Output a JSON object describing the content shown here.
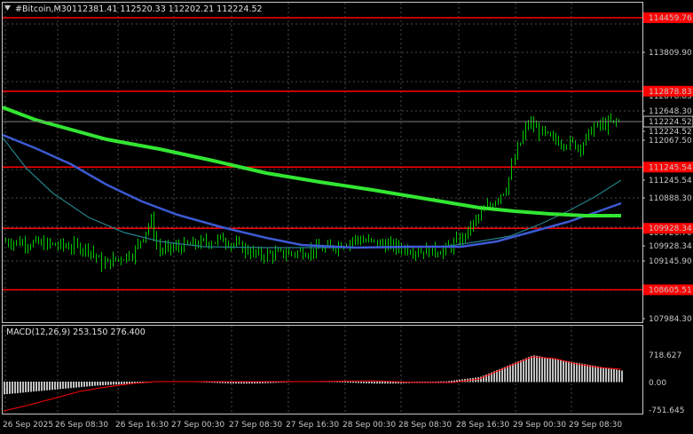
{
  "header": {
    "symbol": "#Bitcoin,M30",
    "ohlc": "112381.41 112520.33 112202.21 112224.52",
    "direction_arrow": "triangle-down-icon"
  },
  "price_axis": {
    "labels": [
      "114459.76",
      "113809.90",
      "112878.83",
      "112648.30",
      "112224.52",
      "112067.50",
      "111486.70",
      "111245.54",
      "110888.30",
      "110307.50",
      "109928.34",
      "109726.70",
      "109145.90",
      "108605.51",
      "107984.30"
    ]
  },
  "level_labels": [
    {
      "text": "114459.76",
      "price": 114459.76
    },
    {
      "text": "112878.83",
      "price": 112878.83
    },
    {
      "text": "111245.54",
      "price": 111245.54
    },
    {
      "text": "109928.34",
      "price": 109928.34
    },
    {
      "text": "108605.51",
      "price": 108605.51
    }
  ],
  "current_price": "112224.52",
  "time_axis": {
    "labels": [
      "26 Sep 2025",
      "26 Sep 08:30",
      "26 Sep 16:30",
      "27 Sep 00:30",
      "27 Sep 08:30",
      "27 Sep 16:30",
      "28 Sep 00:30",
      "28 Sep 08:30",
      "28 Sep 16:30",
      "29 Sep 00:30",
      "29 Sep 08:30"
    ]
  },
  "macd": {
    "label": "MACD(12,26,9) 253.150 276.400",
    "axis_labels": [
      "718.627",
      "0.00",
      "-751.645"
    ]
  },
  "colors": {
    "background": "#000000",
    "candle": "#00c800",
    "level_line": "#ff0000",
    "level_label_bg": "#ff0000",
    "ma_fast": "#23808a",
    "ma_mid": "#3c5ad2",
    "ma_slow": "#32e632",
    "macd_hist": "#c0c0c0",
    "macd_signal": "#ff0000"
  },
  "chart_data": {
    "type": "candlestick",
    "title": "#Bitcoin,M30",
    "ylim": [
      107984.3,
      114459.76
    ],
    "horizontal_levels": [
      114459.76,
      112878.83,
      111245.54,
      109928.34,
      108605.51
    ],
    "approx_close_path": [
      {
        "time": "26 Sep 2025",
        "price": 109650
      },
      {
        "time": "26 Sep 08:30",
        "price": 109400
      },
      {
        "time": "26 Sep 16:30",
        "price": 109500
      },
      {
        "time": "27 Sep 00:30",
        "price": 109700
      },
      {
        "time": "27 Sep 08:30",
        "price": 109650
      },
      {
        "time": "27 Sep 16:30",
        "price": 109450
      },
      {
        "time": "28 Sep 00:30",
        "price": 109600
      },
      {
        "time": "28 Sep 08:30",
        "price": 109450
      },
      {
        "time": "28 Sep 16:30",
        "price": 110600
      },
      {
        "time": "29 Sep 00:30",
        "price": 112150
      },
      {
        "time": "29 Sep 08:30",
        "price": 112224.52
      }
    ]
  }
}
